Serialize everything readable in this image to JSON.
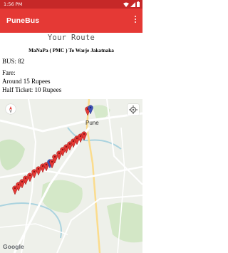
{
  "status_bar": {
    "time": "1:56 PM",
    "accent": "#c62828"
  },
  "app_bar": {
    "title": "PuneBus",
    "menu_icon": "more-vert-icon",
    "color": "#e53935"
  },
  "content": {
    "heading": "Your Route",
    "route": "MaNaPa ( PMC ) To Warje Jakatnaka",
    "bus": "BUS: 82",
    "fare_label": "Fare:",
    "fare_full": "Around 15 Rupees",
    "fare_half": "Half Ticket: 10 Rupees"
  },
  "map": {
    "city_label": "Pune",
    "logo": "Google",
    "compass_icon": "compass-icon",
    "location_icon": "my-location-icon",
    "marker_color": "#e53935",
    "highlight_marker_color": "#3f51b5"
  }
}
